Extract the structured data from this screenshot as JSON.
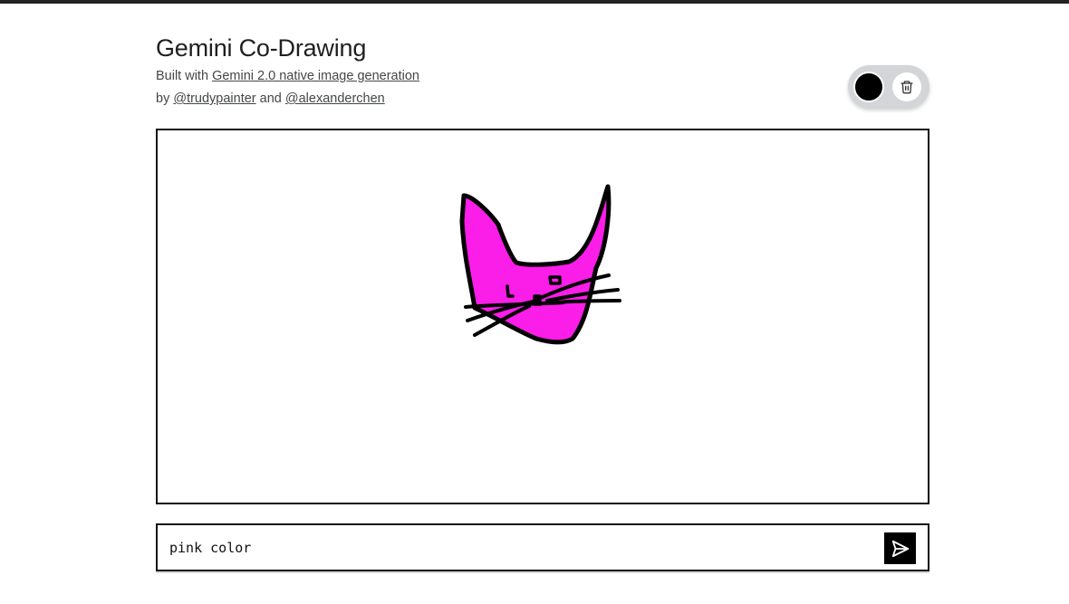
{
  "header": {
    "title": "Gemini Co-Drawing",
    "built_with_prefix": "Built with ",
    "built_with_link": "Gemini 2.0 native image generation",
    "by_prefix": "by ",
    "author1": "@trudypainter",
    "and_text": " and ",
    "author2": "@alexanderchen"
  },
  "toolbar": {
    "selected_color": "#000000",
    "clear_icon": "trash-icon"
  },
  "canvas": {
    "drawing_description_colors": {
      "fill": "#fb1de8",
      "stroke": "#000000"
    }
  },
  "prompt": {
    "value": "pink color",
    "send_icon": "send-icon"
  }
}
